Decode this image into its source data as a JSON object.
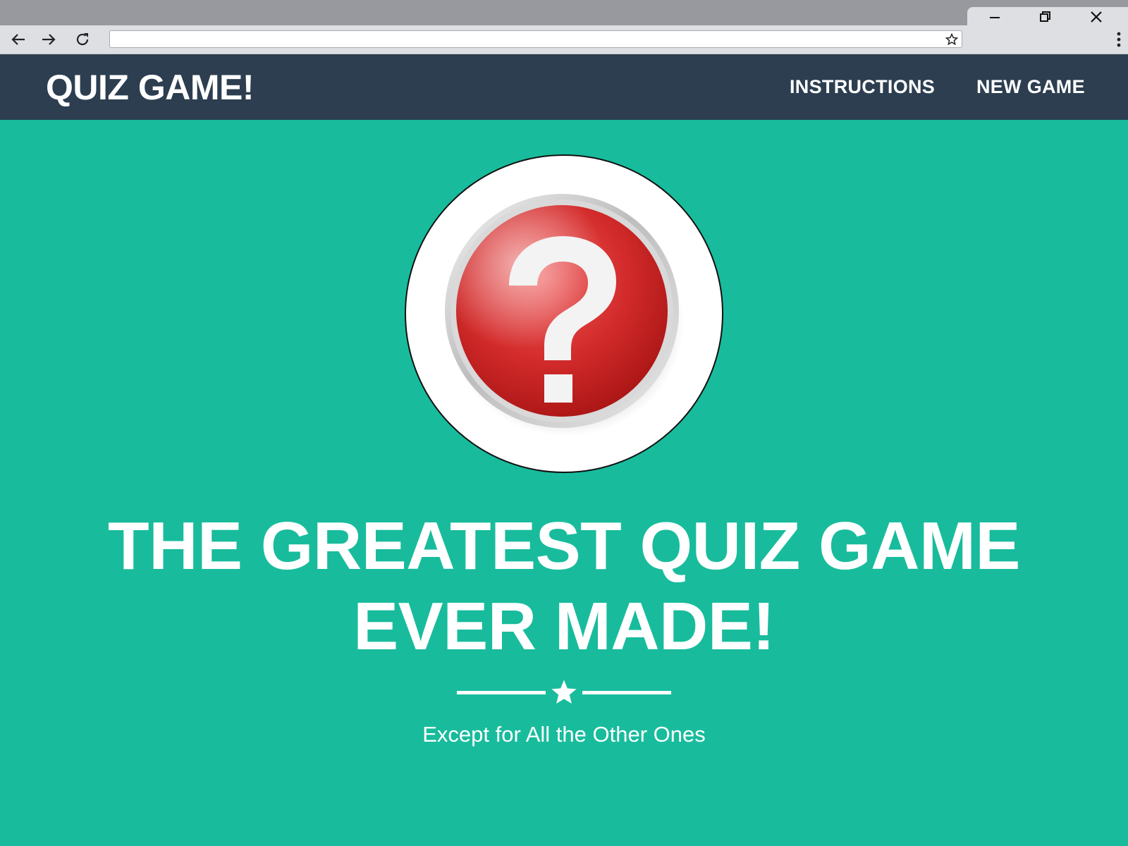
{
  "browser": {
    "window_controls": {
      "minimize_icon": "minimize-icon",
      "restore_icon": "restore-icon",
      "close_icon": "close-icon"
    },
    "nav_icons": [
      "back-arrow-icon",
      "forward-arrow-icon",
      "reload-icon"
    ],
    "address_bar": {
      "value": "",
      "placeholder": ""
    },
    "bookmark_icon": "star-outline-icon",
    "menu_icon": "vertical-dots-icon"
  },
  "site_nav": {
    "brand": "QUIZ GAME!",
    "links": [
      {
        "label": "INSTRUCTIONS"
      },
      {
        "label": "NEW GAME"
      }
    ]
  },
  "hero": {
    "image_icon": "red-question-mark-button-icon",
    "headline_line1": "THE GREATEST QUIZ GAME",
    "headline_line2": "EVER MADE!",
    "divider_icon": "star-icon",
    "subtitle": "Except for All the Other Ones"
  },
  "colors": {
    "page_background": "#18bc9c",
    "navbar_background": "#2c3e50",
    "text": "#ffffff",
    "question_button_red": "#d62b2b"
  }
}
